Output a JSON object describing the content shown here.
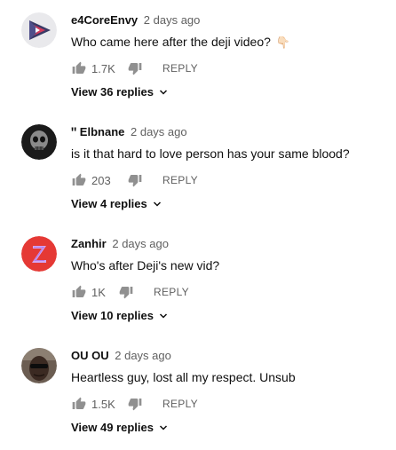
{
  "colors": {
    "author": "#0f0f0f",
    "meta": "#606060",
    "text": "#0f0f0f"
  },
  "comments": [
    {
      "author": "e4CoreEnvy",
      "time": "2 days ago",
      "text": "Who came here after the deji video?",
      "emoji": "👇🏻",
      "likes": "1.7K",
      "reply_label": "REPLY",
      "view_replies": "View 36 replies",
      "avatar_icon": "play-triangle-logo-icon"
    },
    {
      "author": "ꞌꞌ Elbnane",
      "time": "2 days ago",
      "text": "is it that hard to love person has your same blood?",
      "likes": "203",
      "reply_label": "REPLY",
      "view_replies": "View 4 replies",
      "avatar_icon": "dark-skull-avatar"
    },
    {
      "author": "Zanhir",
      "time": "2 days ago",
      "text": "Who's after Deji's new vid?",
      "likes": "1K",
      "reply_label": "REPLY",
      "view_replies": "View 10 replies",
      "avatar_icon": "letter-z-avatar"
    },
    {
      "author": "OU OU",
      "time": "2 days ago",
      "text": "Heartless guy, lost all my respect. Unsub",
      "likes": "1.5K",
      "reply_label": "REPLY",
      "view_replies": "View 49 replies",
      "avatar_icon": "person-sunglasses-avatar"
    }
  ]
}
